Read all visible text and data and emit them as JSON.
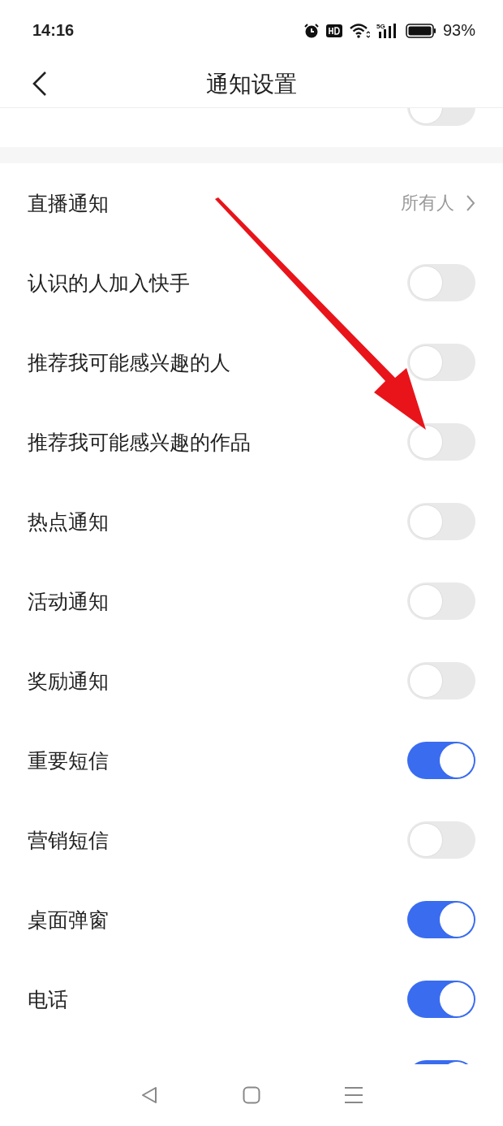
{
  "status_bar": {
    "time": "14:16",
    "network": "5G",
    "battery": "93%"
  },
  "header": {
    "title": "通知设置"
  },
  "sections": [
    {
      "rows": [
        {
          "kind": "toggle",
          "on": false
        }
      ]
    },
    {
      "rows": [
        {
          "kind": "link",
          "label": "直播通知",
          "value": "所有人"
        },
        {
          "kind": "toggle",
          "label": "认识的人加入快手",
          "on": false
        },
        {
          "kind": "toggle",
          "label": "推荐我可能感兴趣的人",
          "on": false
        },
        {
          "kind": "toggle",
          "label": "推荐我可能感兴趣的作品",
          "on": false
        },
        {
          "kind": "toggle",
          "label": "热点通知",
          "on": false
        },
        {
          "kind": "toggle",
          "label": "活动通知",
          "on": false
        },
        {
          "kind": "toggle",
          "label": "奖励通知",
          "on": false
        },
        {
          "kind": "toggle",
          "label": "重要短信",
          "on": true
        },
        {
          "kind": "toggle",
          "label": "营销短信",
          "on": false
        },
        {
          "kind": "toggle",
          "label": "桌面弹窗",
          "on": true
        },
        {
          "kind": "toggle",
          "label": "电话",
          "on": true
        },
        {
          "kind": "toggle",
          "on": true
        }
      ]
    }
  ]
}
